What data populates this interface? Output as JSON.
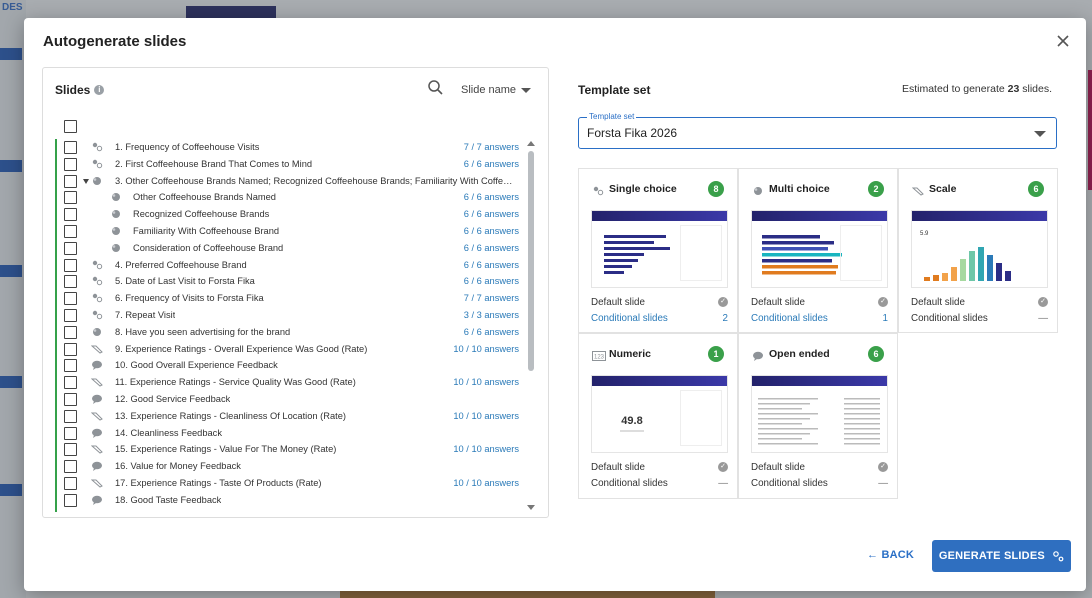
{
  "background": {
    "edge_text": "DES"
  },
  "modal": {
    "title": "Autogenerate slides",
    "close_icon": "close-icon"
  },
  "slides_panel": {
    "title": "Slides",
    "sort_label": "Slide name",
    "rows": [
      {
        "label": "1. Frequency of Coffeehouse Visits",
        "answers": "7 / 7 answers",
        "icon": "single-choice-icon"
      },
      {
        "label": "2. First Coffeehouse Brand That Comes to Mind",
        "answers": "6 / 6 answers",
        "icon": "single-choice-icon"
      },
      {
        "label": "3. Other Coffeehouse Brands Named; Recognized Coffeehouse Brands; Familiarity With Coffee...",
        "answers": "",
        "icon": "multi-choice-icon",
        "expanded": true
      },
      {
        "label": "Other Coffeehouse Brands Named",
        "answers": "6 / 6 answers",
        "icon": "multi-choice-icon",
        "child": true
      },
      {
        "label": "Recognized Coffeehouse Brands",
        "answers": "6 / 6 answers",
        "icon": "multi-choice-icon",
        "child": true
      },
      {
        "label": "Familiarity With Coffeehouse Brand",
        "answers": "6 / 6 answers",
        "icon": "multi-choice-icon",
        "child": true
      },
      {
        "label": "Consideration of Coffeehouse Brand",
        "answers": "6 / 6 answers",
        "icon": "multi-choice-icon",
        "child": true
      },
      {
        "label": "4. Preferred Coffeehouse Brand",
        "answers": "6 / 6 answers",
        "icon": "single-choice-icon"
      },
      {
        "label": "5. Date of Last Visit to Forsta Fika",
        "answers": "6 / 6 answers",
        "icon": "single-choice-icon"
      },
      {
        "label": "6. Frequency of Visits to Forsta Fika",
        "answers": "7 / 7 answers",
        "icon": "single-choice-icon"
      },
      {
        "label": "7. Repeat Visit",
        "answers": "3 / 3 answers",
        "icon": "single-choice-icon"
      },
      {
        "label": "8. Have you seen advertising for the brand",
        "answers": "6 / 6 answers",
        "icon": "multi-choice-icon"
      },
      {
        "label": "9. Experience Ratings - Overall Experience Was Good (Rate)",
        "answers": "10 / 10 answers",
        "icon": "scale-icon"
      },
      {
        "label": "10. Good Overall Experience Feedback",
        "answers": "",
        "icon": "open-ended-icon"
      },
      {
        "label": "11. Experience Ratings - Service Quality Was Good (Rate)",
        "answers": "10 / 10 answers",
        "icon": "scale-icon"
      },
      {
        "label": "12. Good Service Feedback",
        "answers": "",
        "icon": "open-ended-icon"
      },
      {
        "label": "13. Experience Ratings - Cleanliness Of Location (Rate)",
        "answers": "10 / 10 answers",
        "icon": "scale-icon"
      },
      {
        "label": "14. Cleanliness Feedback",
        "answers": "",
        "icon": "open-ended-icon"
      },
      {
        "label": "15. Experience Ratings - Value For The Money (Rate)",
        "answers": "10 / 10 answers",
        "icon": "scale-icon"
      },
      {
        "label": "16. Value for Money Feedback",
        "answers": "",
        "icon": "open-ended-icon"
      },
      {
        "label": "17. Experience Ratings - Taste Of Products (Rate)",
        "answers": "10 / 10 answers",
        "icon": "scale-icon"
      },
      {
        "label": "18. Good Taste Feedback",
        "answers": "",
        "icon": "open-ended-icon"
      }
    ]
  },
  "template": {
    "heading": "Template set",
    "estimate_prefix": "Estimated to generate",
    "estimate_count": "23",
    "estimate_suffix": "slides.",
    "select_legend": "Template set",
    "select_value": "Forsta Fika 2026",
    "cards": [
      {
        "title": "Single choice",
        "count": "8",
        "icon": "single-choice-icon",
        "thumb": "bars-h",
        "thumb_value": "",
        "default_label": "Default slide",
        "conditional_label": "Conditional slides",
        "conditional_value": "2",
        "conditional_link": true
      },
      {
        "title": "Multi choice",
        "count": "2",
        "icon": "multi-choice-icon",
        "thumb": "bars-multi",
        "thumb_value": "",
        "default_label": "Default slide",
        "conditional_label": "Conditional slides",
        "conditional_value": "1",
        "conditional_link": true
      },
      {
        "title": "Scale",
        "count": "6",
        "icon": "scale-icon",
        "thumb": "bars-v",
        "thumb_value": "5.9",
        "default_label": "Default slide",
        "conditional_label": "Conditional slides",
        "conditional_value": "—",
        "conditional_link": false
      },
      {
        "title": "Numeric",
        "count": "1",
        "icon": "numeric-icon",
        "thumb": "number",
        "thumb_value": "49.8",
        "default_label": "Default slide",
        "conditional_label": "Conditional slides",
        "conditional_value": "—",
        "conditional_link": false
      },
      {
        "title": "Open ended",
        "count": "6",
        "icon": "open-ended-icon",
        "thumb": "text",
        "thumb_value": "",
        "default_label": "Default slide",
        "conditional_label": "Conditional slides",
        "conditional_value": "—",
        "conditional_link": false
      }
    ]
  },
  "footer": {
    "back_label": "← BACK",
    "generate_label": "GENERATE SLIDES"
  },
  "colors": {
    "accent": "#2f6fc0",
    "badge": "#3aa04a",
    "link": "#2a7ab8"
  }
}
